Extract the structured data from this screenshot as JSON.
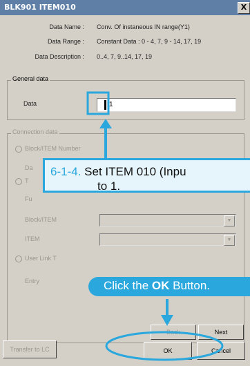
{
  "window": {
    "title": "BLK901 ITEM010",
    "close_glyph": "X"
  },
  "info": {
    "data_name_label": "Data Name :",
    "data_name_value": "Conv. Of instaneous IN range(Y1)",
    "data_range_label": "Data Range :",
    "data_range_value": "Constant Data : 0 - 4, 7, 9 - 14, 17, 19",
    "data_desc_label": "Data Description :",
    "data_desc_value": "0..4, 7, 9..14, 17, 19"
  },
  "general": {
    "title": "General data",
    "data_label": "Data",
    "data_value": "1"
  },
  "connection": {
    "title": "Connection data",
    "block_item_number": "Block/ITEM Number",
    "row2_label": "Da",
    "radio2_label": "T",
    "row4_label": "Fu",
    "block_item_label": "Block/ITEM",
    "item_label": "ITEM",
    "user_link_label": "User Link T",
    "entry_label": "Entry"
  },
  "buttons": {
    "back": "Back",
    "next": "Next",
    "transfer": "Transfer to LC",
    "ok": "OK",
    "cancel": "Cancel"
  },
  "callouts": {
    "step_number": "6-1-4.",
    "step_text_1": " Set ITEM 010 (Inpu",
    "step_text_2": "to 1.",
    "click_prefix": "Click the ",
    "click_bold": "OK",
    "click_suffix": " Button."
  },
  "colors": {
    "accent": "#2aa7dd",
    "callout_bg": "#e6f5fc",
    "title_bar": "#5f7fa6",
    "window_bg": "#d4d0c8"
  }
}
